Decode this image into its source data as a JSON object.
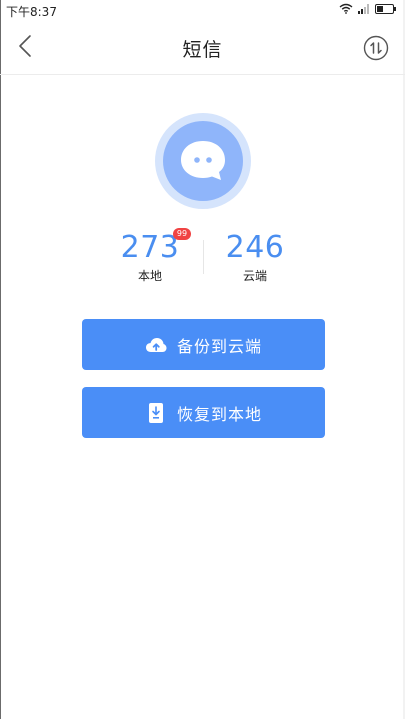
{
  "status_bar": {
    "time": "下午8:37"
  },
  "header": {
    "title": "短信",
    "back_icon": "chevron-left-icon",
    "sync_icon": "sync-arrows-icon"
  },
  "hero": {
    "icon": "chat-bubble-icon"
  },
  "counts": {
    "local": {
      "value": "273",
      "label": "本地",
      "badge": "99"
    },
    "cloud": {
      "value": "246",
      "label": "云端"
    }
  },
  "actions": {
    "backup": {
      "label": "备份到云端",
      "icon": "cloud-upload-icon"
    },
    "restore": {
      "label": "恢复到本地",
      "icon": "phone-download-icon"
    }
  },
  "colors": {
    "accent": "#4a8ef7",
    "count_text": "#4a8ef0",
    "badge": "#f04343",
    "hero_outer": "#d5e4fc",
    "hero_inner": "#8fb5fa"
  }
}
